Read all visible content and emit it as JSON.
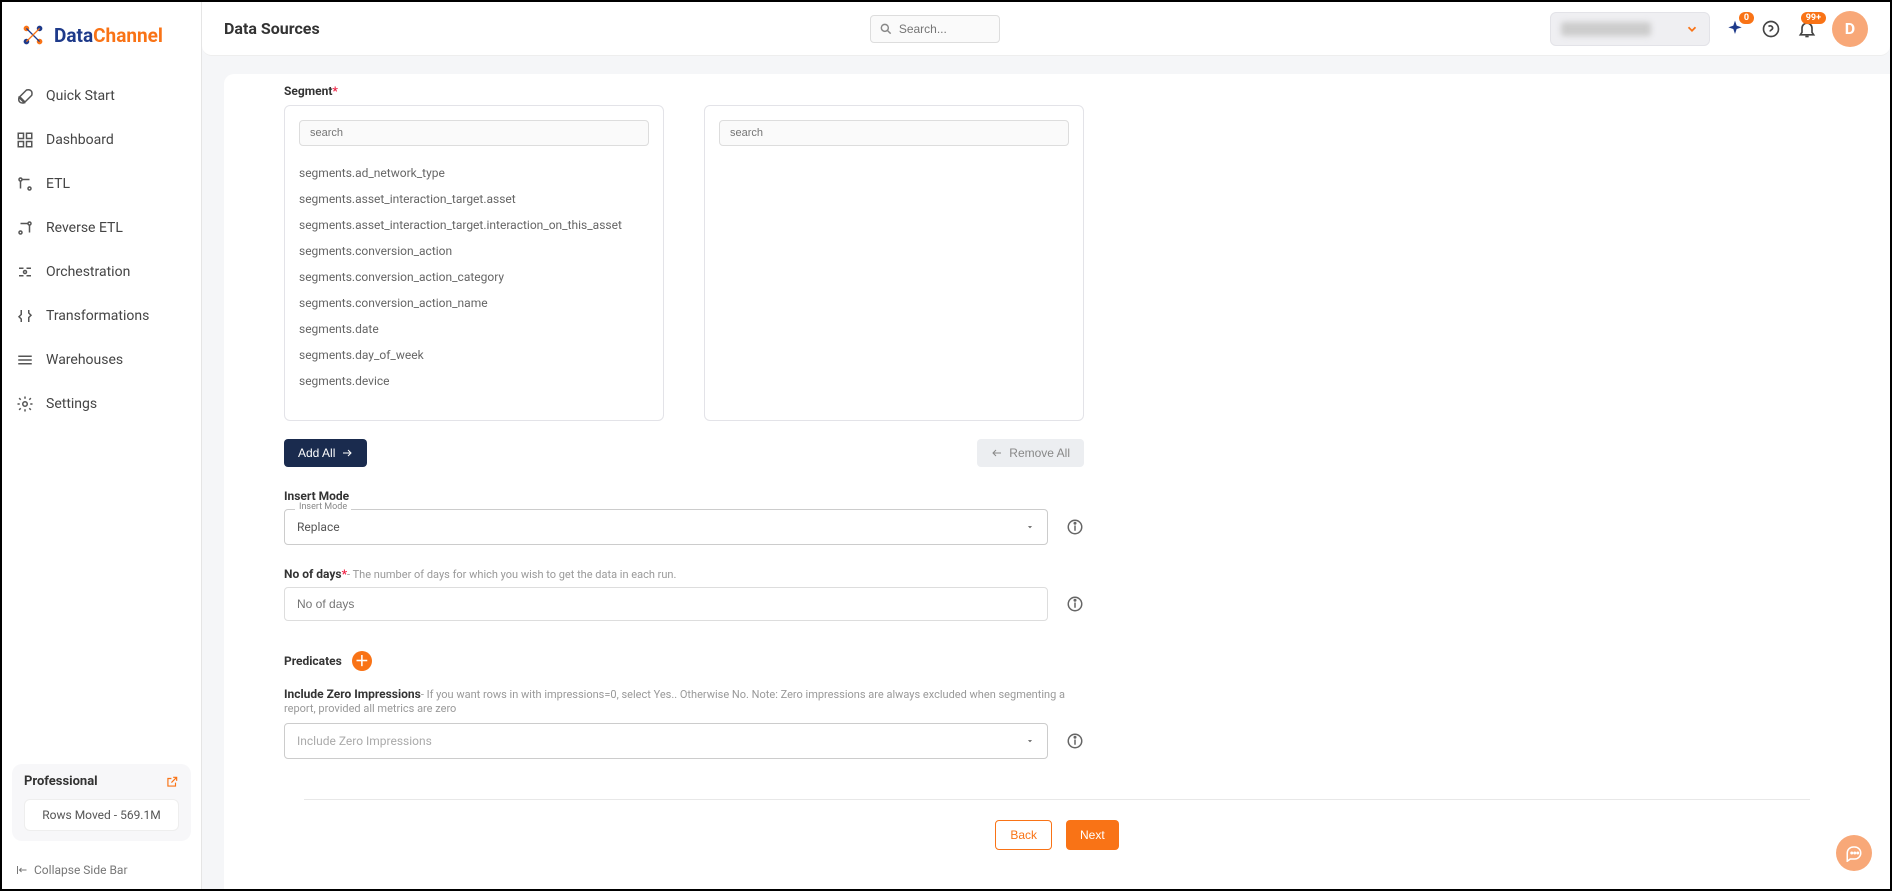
{
  "header": {
    "title": "Data Sources",
    "search_placeholder": "Search...",
    "notif_badge": "0",
    "bell_badge": "99+",
    "avatar_letter": "D"
  },
  "logo": {
    "blue": "Data",
    "orange": "Channel"
  },
  "sidebar": {
    "items": [
      {
        "label": "Quick Start"
      },
      {
        "label": "Dashboard"
      },
      {
        "label": "ETL"
      },
      {
        "label": "Reverse ETL"
      },
      {
        "label": "Orchestration"
      },
      {
        "label": "Transformations"
      },
      {
        "label": "Warehouses"
      },
      {
        "label": "Settings"
      }
    ],
    "plan_title": "Professional",
    "plan_sub": "Rows Moved - 569.1M",
    "collapse": "Collapse Side Bar"
  },
  "segment": {
    "label": "Segment",
    "left_search_ph": "search",
    "right_search_ph": "search",
    "items": [
      "segments.ad_network_type",
      "segments.asset_interaction_target.asset",
      "segments.asset_interaction_target.interaction_on_this_asset",
      "segments.conversion_action",
      "segments.conversion_action_category",
      "segments.conversion_action_name",
      "segments.date",
      "segments.day_of_week",
      "segments.device"
    ],
    "add_all": "Add All",
    "remove_all": "Remove All"
  },
  "insert_mode": {
    "label": "Insert Mode",
    "float": "Insert Mode",
    "value": "Replace"
  },
  "no_of_days": {
    "label": "No of days",
    "hint": "- The number of days for which you wish to get the data in each run.",
    "placeholder": "No of days"
  },
  "predicates": {
    "label": "Predicates"
  },
  "include_zero": {
    "label": "Include Zero Impressions",
    "hint": "- If you want rows in with impressions=0, select Yes.. Otherwise No. Note: Zero impressions are always excluded when segmenting a report, provided all metrics are zero",
    "placeholder": "Include Zero Impressions"
  },
  "footer": {
    "back": "Back",
    "next": "Next"
  }
}
